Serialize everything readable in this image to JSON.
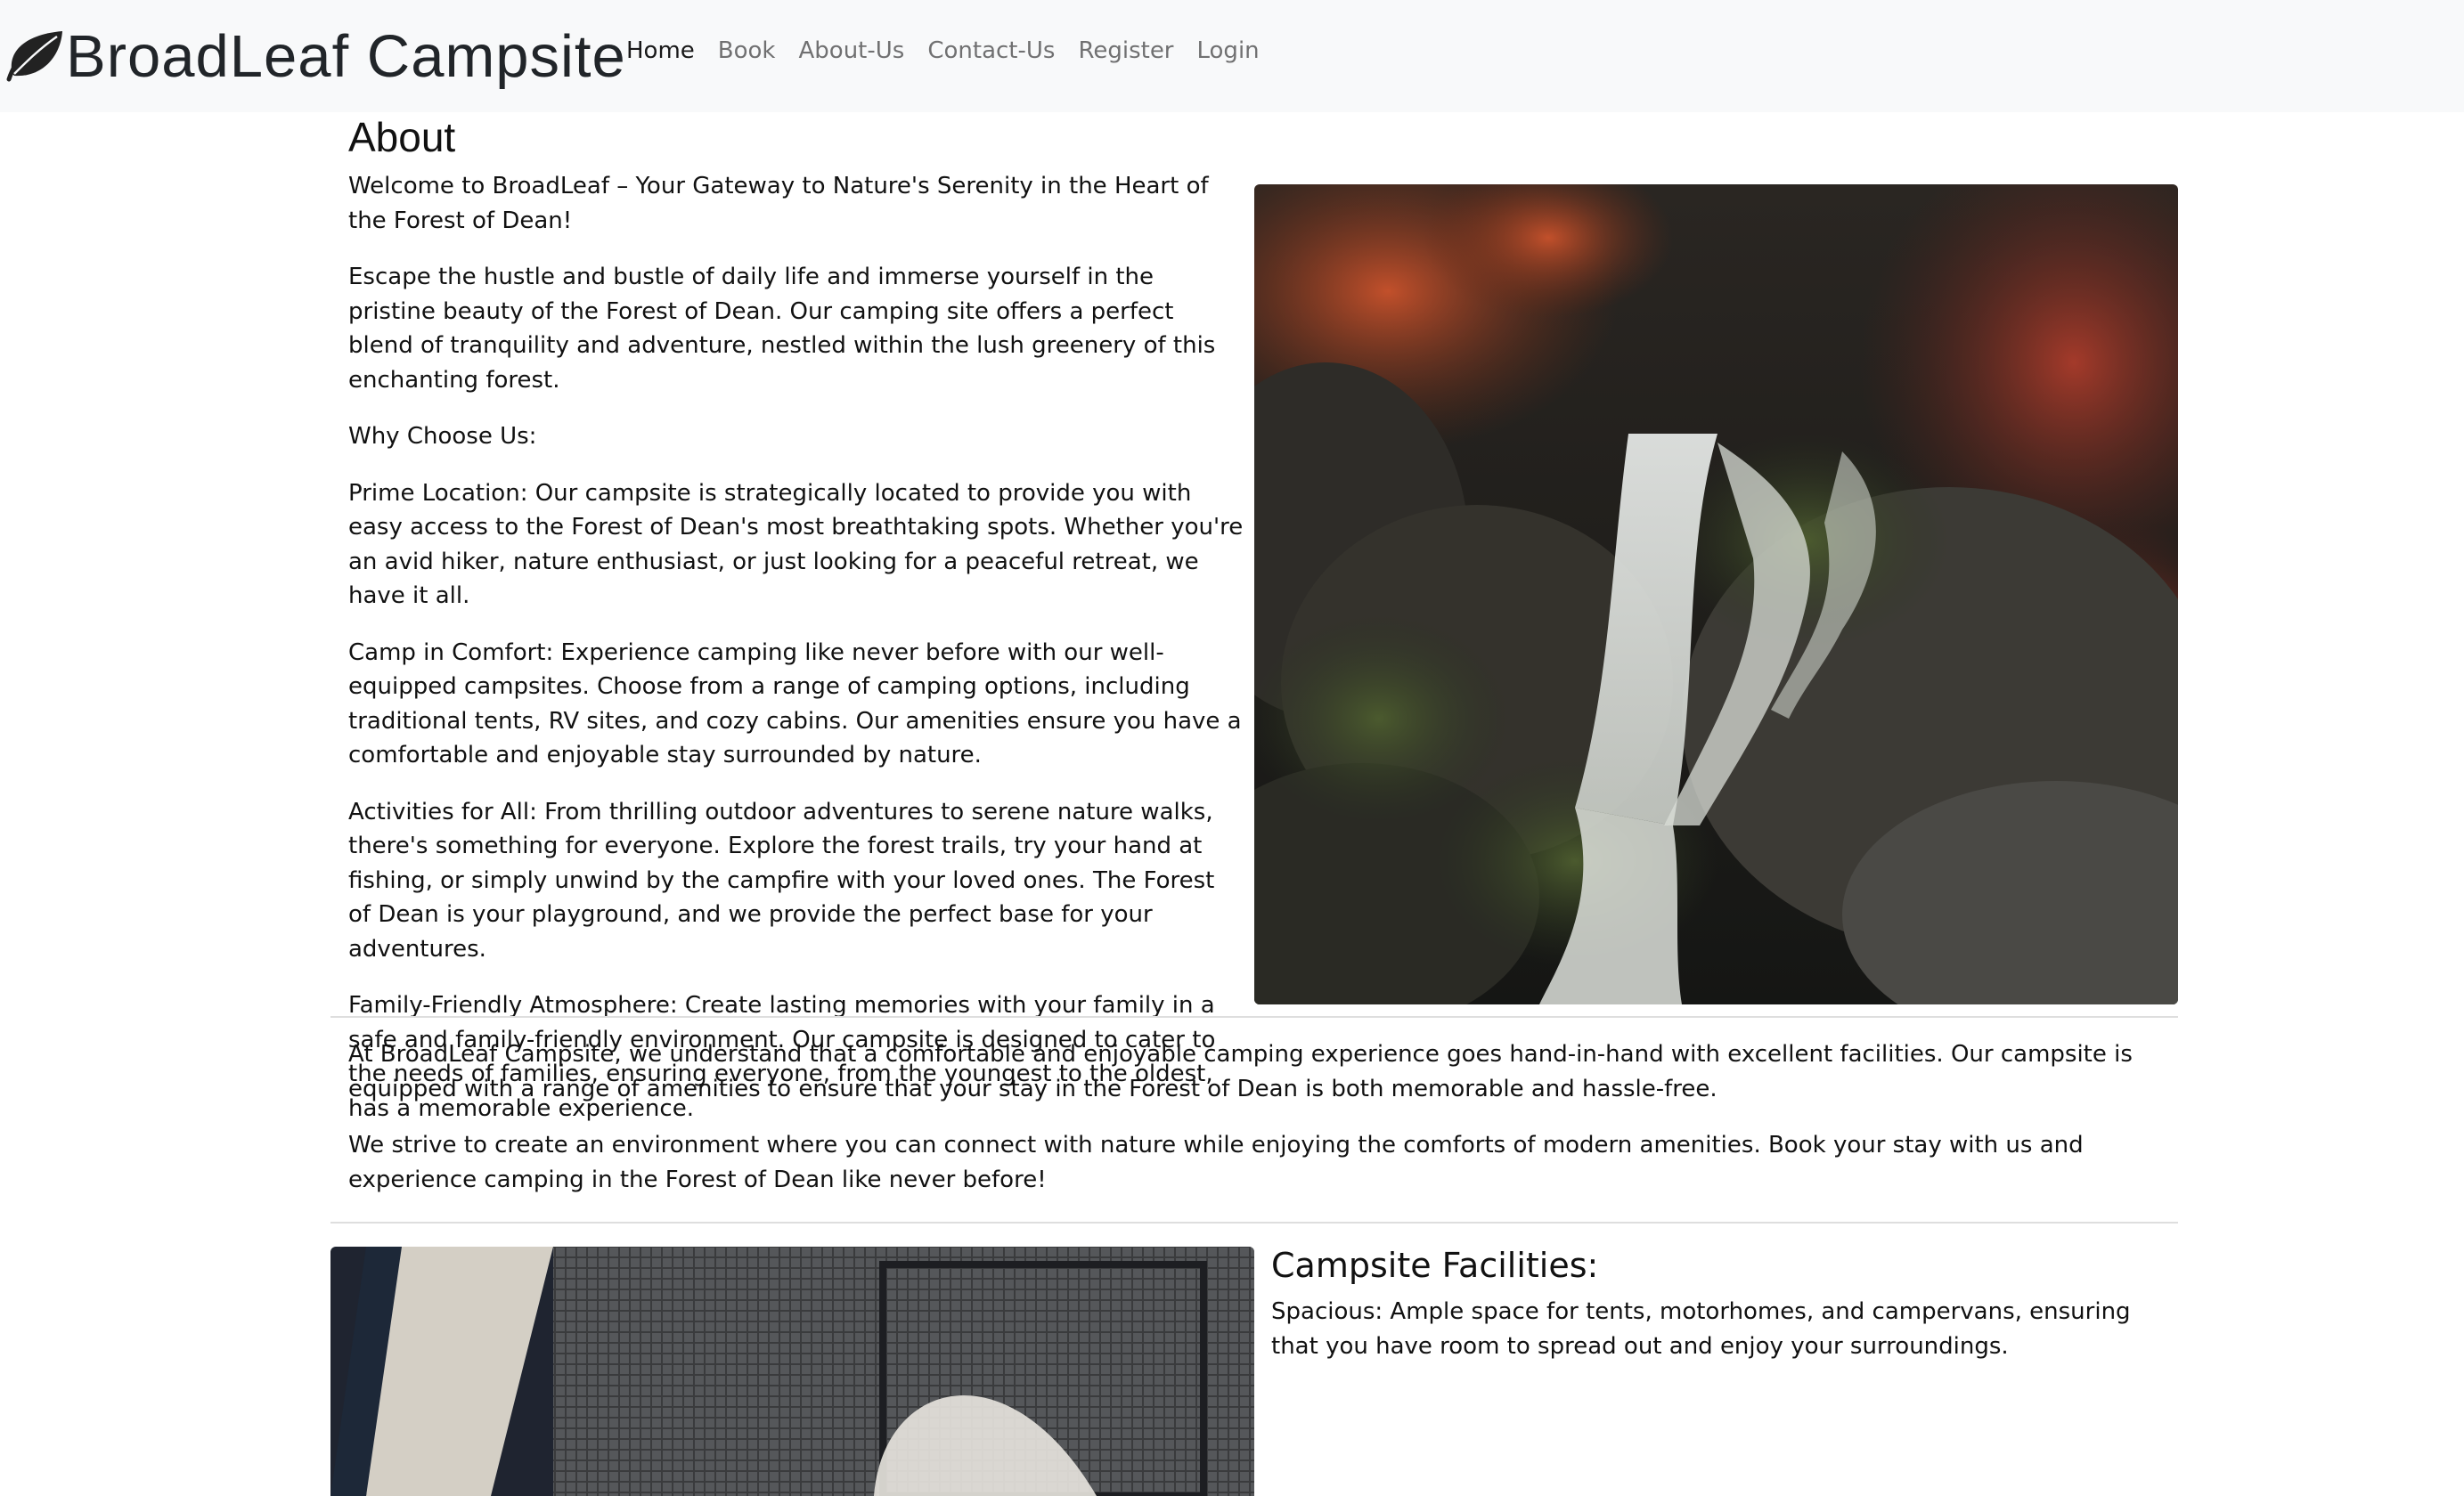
{
  "navbar": {
    "brand_text": "BroadLeaf Campsite",
    "brand_icon": "leaf-icon",
    "links": [
      {
        "label": "Home",
        "active": true
      },
      {
        "label": "Book"
      },
      {
        "label": "About-Us"
      },
      {
        "label": "Contact-Us"
      },
      {
        "label": "Register"
      },
      {
        "label": "Login"
      }
    ]
  },
  "about": {
    "heading": "About",
    "paragraphs": [
      "Welcome to BroadLeaf – Your Gateway to Nature's Serenity in the Heart of the Forest of Dean!",
      "Escape the hustle and bustle of daily life and immerse yourself in the pristine beauty of the Forest of Dean. Our camping site offers a perfect blend of tranquility and adventure, nestled within the lush greenery of this enchanting forest.",
      "Why Choose Us:",
      "Prime Location: Our campsite is strategically located to provide you with easy access to the Forest of Dean's most breathtaking spots. Whether you're an avid hiker, nature enthusiast, or just looking for a peaceful retreat, we have it all.",
      "Camp in Comfort: Experience camping like never before with our well-equipped campsites. Choose from a range of camping options, including traditional tents, RV sites, and cozy cabins. Our amenities ensure you have a comfortable and enjoyable stay surrounded by nature.",
      "Activities for All: From thrilling outdoor adventures to serene nature walks, there's something for everyone. Explore the forest trails, try your hand at fishing, or simply unwind by the campfire with your loved ones. The Forest of Dean is your playground, and we provide the perfect base for your adventures.",
      "Family-Friendly Atmosphere: Create lasting memories with your family in a safe and family-friendly environment. Our campsite is designed to cater to the needs of families, ensuring everyone, from the youngest to the oldest, has a memorable experience."
    ]
  },
  "middle": {
    "paragraphs": [
      "At BroadLeaf Campsite, we understand that a comfortable and enjoyable camping experience goes hand-in-hand with excellent facilities. Our campsite is equipped with a range of amenities to ensure that your stay in the Forest of Dean is both memorable and hassle-free.",
      "We strive to create an environment where you can connect with nature while enjoying the comforts of modern amenities. Book your stay with us and experience camping in the Forest of Dean like never before!"
    ]
  },
  "facilities": {
    "heading": "Campsite Facilities:",
    "paragraphs": [
      "Spacious: Ample space for tents, motorhomes, and campervans, ensuring that you have room to spread out and enjoy your surroundings."
    ]
  },
  "colors": {
    "navbar_bg": "#f8f9fa",
    "divider": "#dedede"
  }
}
